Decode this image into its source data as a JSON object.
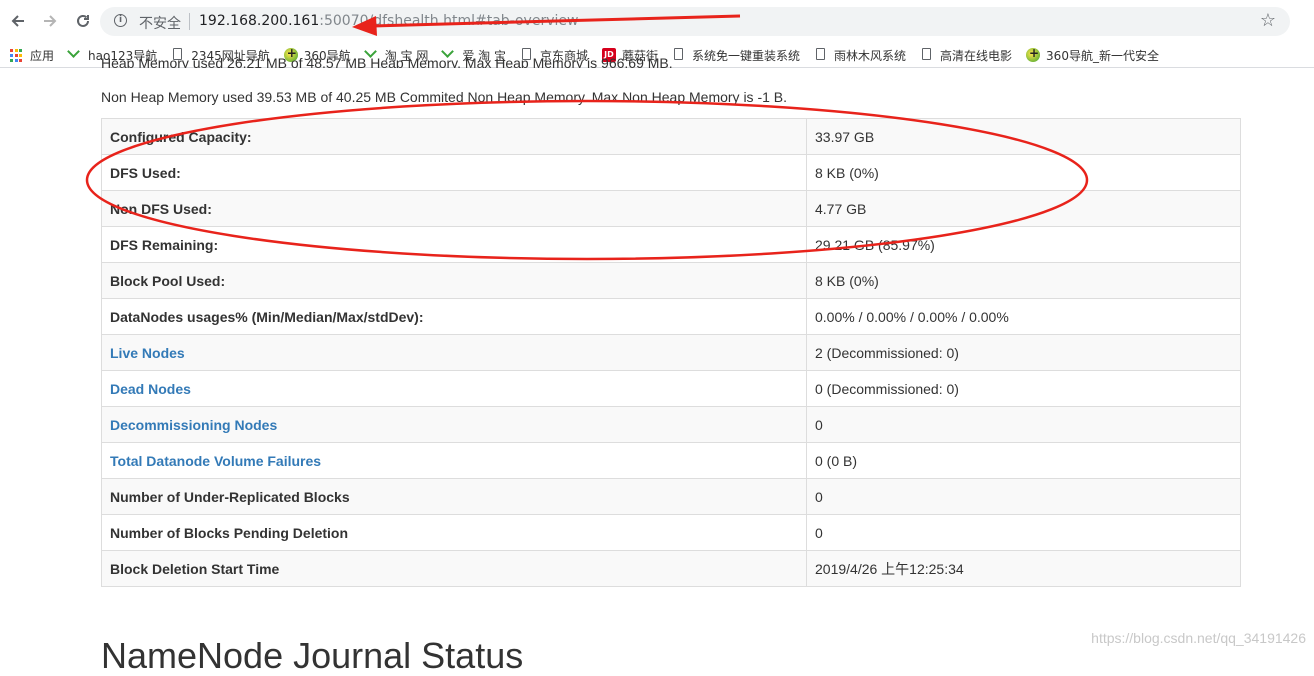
{
  "browser": {
    "insecure_label": "不安全",
    "url_host": "192.168.200.161",
    "url_rest": ":50070/dfshealth.html#tab-overview",
    "back_icon": "back-arrow-icon",
    "forward_icon": "forward-arrow-icon",
    "reload_icon": "reload-icon",
    "star_icon": "star-icon"
  },
  "bookmarks": [
    {
      "label": "应用",
      "icon": "apps-icon"
    },
    {
      "label": "hao123导航",
      "icon": "hao-icon"
    },
    {
      "label": "2345网址导航",
      "icon": "page-icon"
    },
    {
      "label": "360导航",
      "icon": "s360-icon"
    },
    {
      "label": "淘 宝 网",
      "icon": "hao-icon"
    },
    {
      "label": "爱 淘 宝",
      "icon": "hao-icon"
    },
    {
      "label": "京东商城",
      "icon": "page-icon"
    },
    {
      "label": "蘑菇街",
      "icon": "jd-icon"
    },
    {
      "label": "系统免一键重装系统",
      "icon": "page-icon"
    },
    {
      "label": "雨林木风系统",
      "icon": "page-icon"
    },
    {
      "label": "高清在线电影",
      "icon": "page-icon"
    },
    {
      "label": "360导航_新一代安全",
      "icon": "s360-icon"
    }
  ],
  "page": {
    "heap_line": "Heap Memory used 26.21 MB of 48.57 MB Heap Memory. Max Heap Memory is 966.69 MB.",
    "nonheap_line": "Non Heap Memory used 39.53 MB of 40.25 MB Commited Non Heap Memory. Max Non Heap Memory is -1 B.",
    "rows": [
      {
        "key": "Configured Capacity:",
        "value": "33.97 GB",
        "link": false
      },
      {
        "key": "DFS Used:",
        "value": "8 KB (0%)",
        "link": false
      },
      {
        "key": "Non DFS Used:",
        "value": "4.77 GB",
        "link": false
      },
      {
        "key": "DFS Remaining:",
        "value": "29.21 GB (85.97%)",
        "link": false
      },
      {
        "key": "Block Pool Used:",
        "value": "8 KB (0%)",
        "link": false
      },
      {
        "key": "DataNodes usages% (Min/Median/Max/stdDev):",
        "value": "0.00% / 0.00% / 0.00% / 0.00%",
        "link": false
      },
      {
        "key": "Live Nodes",
        "value": "2 (Decommissioned: 0)",
        "link": true
      },
      {
        "key": "Dead Nodes",
        "value": "0 (Decommissioned: 0)",
        "link": true
      },
      {
        "key": "Decommissioning Nodes",
        "value": "0",
        "link": true
      },
      {
        "key": "Total Datanode Volume Failures",
        "value": "0 (0 B)",
        "link": true
      },
      {
        "key": "Number of Under-Replicated Blocks",
        "value": "0",
        "link": false
      },
      {
        "key": "Number of Blocks Pending Deletion",
        "value": "0",
        "link": false
      },
      {
        "key": "Block Deletion Start Time",
        "value": "2019/4/26 上午12:25:34",
        "link": false
      }
    ],
    "section_title": "NameNode Journal Status"
  },
  "watermark": "https://blog.csdn.net/qq_34191426",
  "colors": {
    "link": "#337ab7",
    "annotation_red": "#e8231b"
  }
}
